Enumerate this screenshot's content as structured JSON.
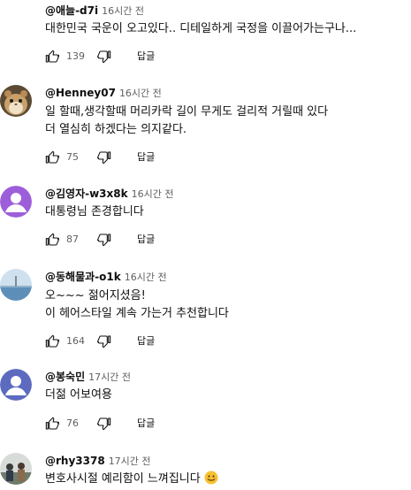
{
  "comments": [
    {
      "author": "@애늘-d7i",
      "time": "16시간 전",
      "lines": [
        "대한민국 국운이 오고있다..  디테일하게 국정을 이끌어가는구나..."
      ],
      "likes": "139",
      "reply": "답글",
      "avatar": "none"
    },
    {
      "author": "@Henney07",
      "time": "16시간 전",
      "lines": [
        "일 할때,생각할때 머리카락 길이 무게도 걸리적 거릴때 있다",
        "더 열심히 하겠다는 의지같다."
      ],
      "likes": "75",
      "reply": "답글",
      "avatar": "hamster-photo"
    },
    {
      "author": "@김영자-w3x8k",
      "time": "16시간 전",
      "lines": [
        "대통령님 존경합니다"
      ],
      "likes": "87",
      "reply": "답글",
      "avatar": "default-user-purple",
      "avatar_color": "#9c5fd9"
    },
    {
      "author": "@동해물과-o1k",
      "time": "16시간 전",
      "lines": [
        "오~~~ 젊어지셨음!",
        "이 헤어스타일 계속 가는거 추천합니다"
      ],
      "likes": "164",
      "reply": "답글",
      "avatar": "sea-photo"
    },
    {
      "author": "@봉숙민",
      "time": "17시간 전",
      "lines": [
        "더젊 어보여용"
      ],
      "likes": "76",
      "reply": "답글",
      "avatar": "default-user-blue",
      "avatar_color": "#5c6bc0"
    },
    {
      "author": "@rhy3378",
      "time": "17시간 전",
      "lines": [
        "변호사시절 예리함이 느껴집니다"
      ],
      "emoji": "smiling-face-emoji",
      "avatar": "people-photo"
    }
  ]
}
